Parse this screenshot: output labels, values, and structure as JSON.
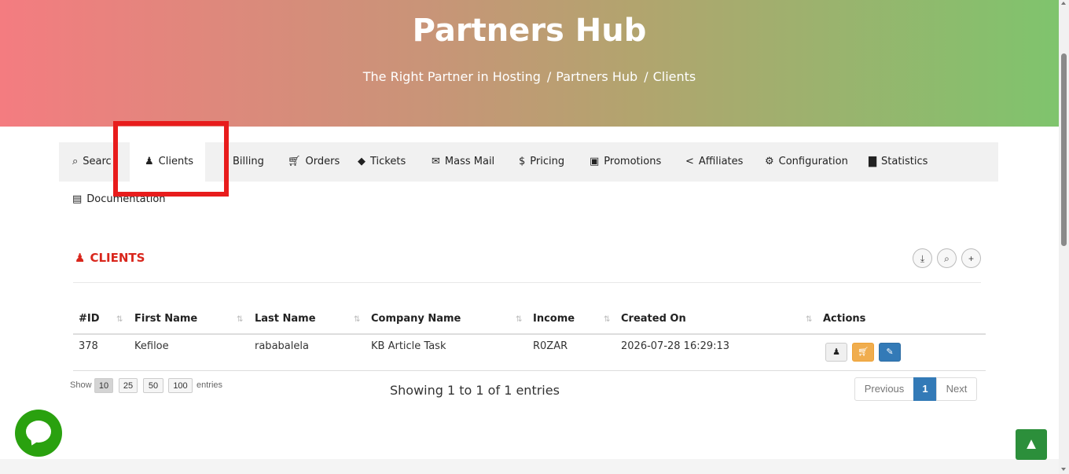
{
  "header": {
    "title": "Partners Hub",
    "breadcrumb": [
      "The Right Partner in Hosting",
      "Partners Hub",
      "Clients"
    ],
    "breadcrumb_sep": "/"
  },
  "nav": {
    "items": [
      {
        "label": "Search",
        "icon": "search-icon"
      },
      {
        "label": "Clients",
        "icon": "users-icon",
        "active": true
      },
      {
        "label": "Billing",
        "icon": "billing-icon"
      },
      {
        "label": "Orders",
        "icon": "cart-icon"
      },
      {
        "label": "Tickets",
        "icon": "ticket-icon"
      },
      {
        "label": "Mass Mail",
        "icon": "envelope-icon"
      },
      {
        "label": "Pricing",
        "icon": "dollar-icon"
      },
      {
        "label": "Promotions",
        "icon": "money-icon"
      },
      {
        "label": "Affiliates",
        "icon": "share-icon"
      },
      {
        "label": "Configuration",
        "icon": "gears-icon"
      },
      {
        "label": "Statistics",
        "icon": "bar-chart-icon"
      },
      {
        "label": "Documentation",
        "icon": "book-icon"
      }
    ],
    "search_visible_text": "Searc"
  },
  "section": {
    "title": "CLIENTS",
    "tools": [
      {
        "name": "export",
        "icon": "download-icon",
        "glyph": "⤓"
      },
      {
        "name": "search",
        "icon": "search-icon",
        "glyph": "⌕"
      },
      {
        "name": "add",
        "icon": "plus-icon",
        "glyph": "+"
      }
    ]
  },
  "table": {
    "columns": [
      "#ID",
      "First Name",
      "Last Name",
      "Company Name",
      "Income",
      "Created On",
      "Actions"
    ],
    "rows": [
      {
        "id": "378",
        "first_name": "Kefiloe",
        "last_name": "rababalela",
        "company": "KB Article Task",
        "income": "R0ZAR",
        "created_on": "2026-07-28 16:29:13"
      }
    ]
  },
  "footer": {
    "show_label": "Show",
    "entries_label": "entries",
    "page_sizes": [
      "10",
      "25",
      "50",
      "100"
    ],
    "selected_page_size": "10",
    "info": "Showing 1 to 1 of 1 entries",
    "pagination": {
      "previous": "Previous",
      "current": "1",
      "next": "Next"
    }
  },
  "colors": {
    "accent_red": "#d9261c",
    "highlight_red": "#e81c1c",
    "pager_blue": "#337ab7",
    "chat_green": "#2aa10f",
    "rocket_green": "#2c8f3b",
    "action_cart": "#f0ad4e",
    "action_edit": "#337ab7"
  }
}
